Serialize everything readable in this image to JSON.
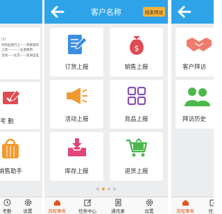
{
  "left_panel": {
    "notes": [
      "[5]",
      "对新品进行上——目家庭装",
      "上架————业游费用",
      "活动——北京——奥海出差"
    ],
    "cards": [
      {
        "label": "考    勤"
      },
      {
        "label": "销售助手"
      }
    ],
    "tabs": [
      {
        "label": "考勤"
      },
      {
        "label": "设置"
      }
    ]
  },
  "middle_panel": {
    "title": "客户名称",
    "badge": "结束拜访",
    "cards": [
      {
        "label": "订货上报"
      },
      {
        "label": "销售上报"
      },
      {
        "label": "活动上报"
      },
      {
        "label": "竞品上报"
      },
      {
        "label": "库存上报"
      },
      {
        "label": "退货上报"
      }
    ],
    "page_dots": {
      "count": 4,
      "active": 1
    },
    "tabs": [
      {
        "label": "流程事务"
      },
      {
        "label": "任务中心"
      },
      {
        "label": "通讯录"
      },
      {
        "label": "设置"
      }
    ]
  },
  "right_panel": {
    "cards": [
      {
        "label": "客户拜访"
      },
      {
        "label": "拜访历史"
      }
    ],
    "tabs": [
      {
        "label": "流程事务"
      },
      {
        "label": "任务"
      }
    ]
  },
  "colors": {
    "header": "#2ea3ea",
    "badge": "#f2b136",
    "active_tab": "#e2541b",
    "icon_blue": "#3a8ee0",
    "icon_red": "#e04b52",
    "icon_orange": "#f29a2e",
    "icon_purple": "#8a4fb3",
    "icon_pink": "#e0457b",
    "icon_green": "#4cb84c",
    "icon_salmon": "#f07c6b"
  }
}
